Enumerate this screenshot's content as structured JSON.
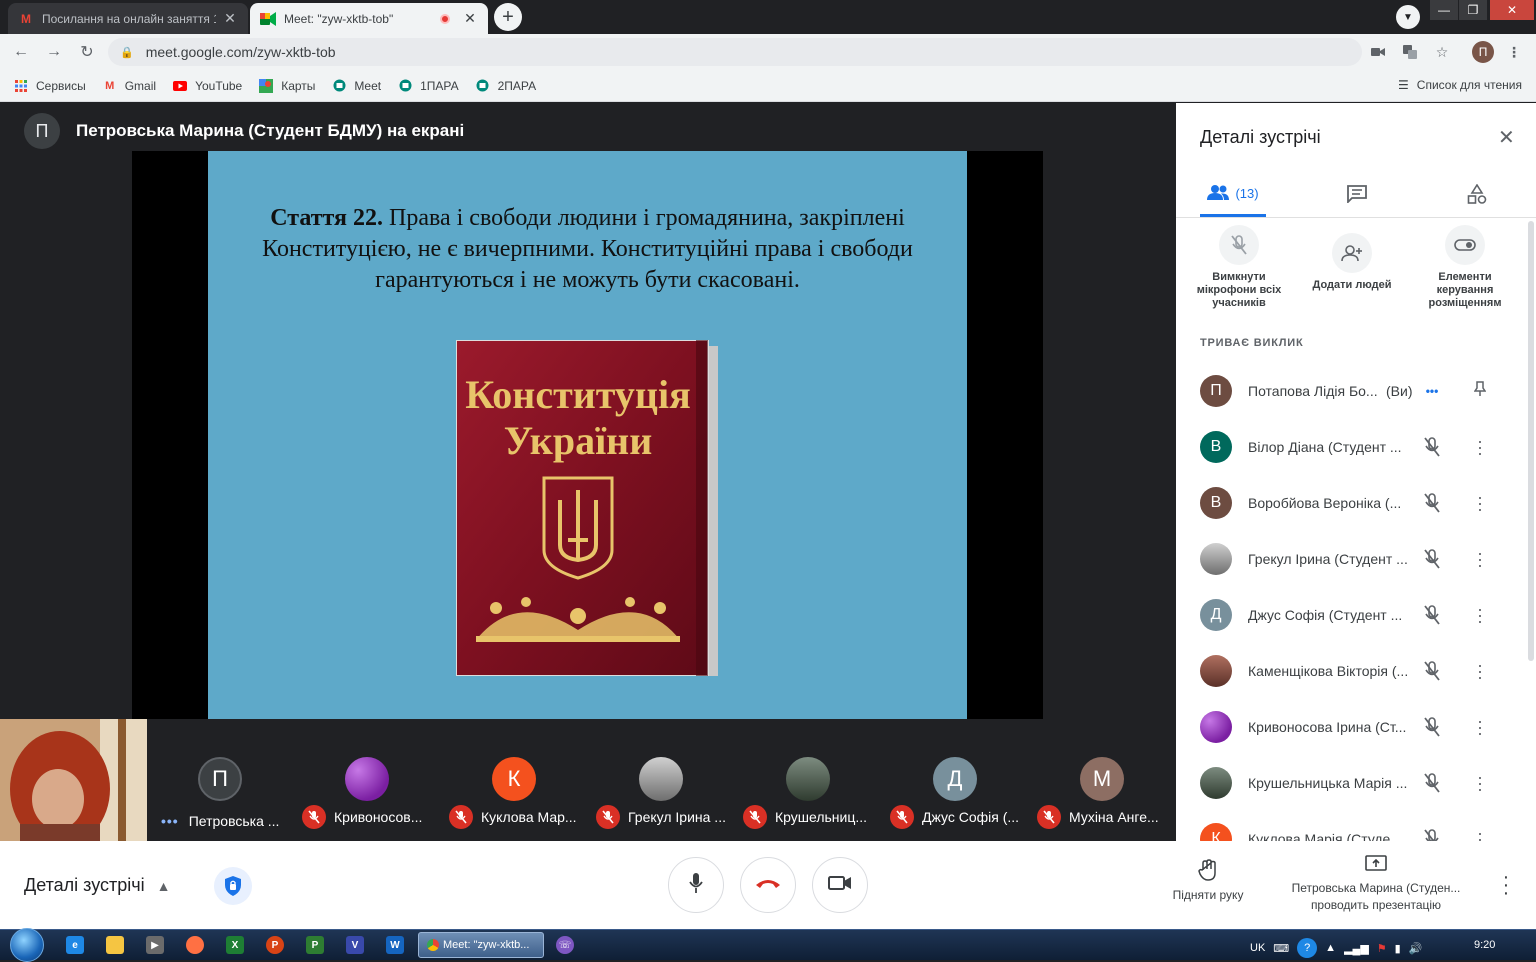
{
  "browser": {
    "tabs": [
      {
        "label": "Посилання на онлайн заняття 1",
        "favicon": "gmail-icon"
      },
      {
        "label": "Meet: \"zyw-xktb-tob\"",
        "favicon": "meet-icon",
        "recording": true
      }
    ],
    "new_tab": "+",
    "url": "meet.google.com/zyw-xktb-tob",
    "profile_initial": "П",
    "bookmarks": [
      {
        "label": "Сервисы",
        "icon": "apps-grid-icon"
      },
      {
        "label": "Gmail",
        "icon": "gmail-icon"
      },
      {
        "label": "YouTube",
        "icon": "youtube-icon"
      },
      {
        "label": "Карты",
        "icon": "maps-icon"
      },
      {
        "label": "Meet",
        "icon": "meet-icon"
      },
      {
        "label": "1ПАРА",
        "icon": "meet-icon"
      },
      {
        "label": "2ПАРА",
        "icon": "meet-icon"
      }
    ],
    "reading_list": "Список для чтения"
  },
  "stage": {
    "presenter_initial": "П",
    "presenter_text": "Петровська Марина (Студент БДМУ) на екрані",
    "slide": {
      "article_bold": "Стаття 22.",
      "article_text": " Права і свободи людини і громадянина, закріплені Конституцією, не є вичерпними. Конституційні права і свободи гарантуються і не можуть бути скасовані.",
      "book_title_line1": "Конституція",
      "book_title_line2": "України"
    }
  },
  "filmstrip": {
    "self_label": "Ви",
    "tiles": [
      {
        "initial": "П",
        "name": "Петровська ...",
        "avatar_color": "#3c4043",
        "muted": false,
        "speaking": true
      },
      {
        "initial": "",
        "name": "Кривоносов...",
        "avatar_color": "#8e24aa",
        "muted": true
      },
      {
        "initial": "К",
        "name": "Куклова Мар...",
        "avatar_color": "#f4511e",
        "muted": true
      },
      {
        "initial": "",
        "name": "Грекул Ірина ...",
        "avatar_color": "#9e9e9e",
        "muted": true
      },
      {
        "initial": "",
        "name": "Крушельниц...",
        "avatar_color": "#455a46",
        "muted": true
      },
      {
        "initial": "Д",
        "name": "Джус Софія (...",
        "avatar_color": "#78909c",
        "muted": true
      },
      {
        "initial": "М",
        "name": "Мухіна Анге...",
        "avatar_color": "#8d6e63",
        "muted": true
      }
    ]
  },
  "controls": {
    "meeting_details": "Деталі зустрічі",
    "raise_hand": "Підняти руку",
    "presenting_line1": "Петровська Марина (Студен...",
    "presenting_line2": "проводить презентацію"
  },
  "panel": {
    "title": "Деталі зустрічі",
    "people_count": "(13)",
    "actions": [
      {
        "label": "Вимкнути мікрофони всіх учасників"
      },
      {
        "label": "Додати людей"
      },
      {
        "label": "Елементи керування розміщенням"
      }
    ],
    "section_label": "ТРИВАЄ ВИКЛИК",
    "participants": [
      {
        "initial": "П",
        "name": "Потапова Лідія Бо...",
        "you": "(Ви)",
        "color": "#6d4c41"
      },
      {
        "initial": "В",
        "name": "Вілор Діана (Студент ...",
        "color": "#00695c"
      },
      {
        "initial": "В",
        "name": "Воробйова Вероніка (...",
        "color": "#6d4c41"
      },
      {
        "initial": "",
        "name": "Грекул Ірина (Студент ...",
        "color": "#9e9e9e"
      },
      {
        "initial": "Д",
        "name": "Джус Софія (Студент ...",
        "color": "#78909c"
      },
      {
        "initial": "",
        "name": "Каменщікова Вікторія (...",
        "color": "#8d5a4a"
      },
      {
        "initial": "",
        "name": "Кривоносова Ірина (Ст...",
        "color": "#8e24aa"
      },
      {
        "initial": "",
        "name": "Крушельницька Марія ...",
        "color": "#455a46"
      },
      {
        "initial": "К",
        "name": "Куклова Марія (Студе...",
        "color": "#f4511e"
      }
    ]
  },
  "taskbar": {
    "chrome_task": "Meet: \"zyw-xktb...",
    "lang": "UK",
    "clock": "9:20"
  }
}
